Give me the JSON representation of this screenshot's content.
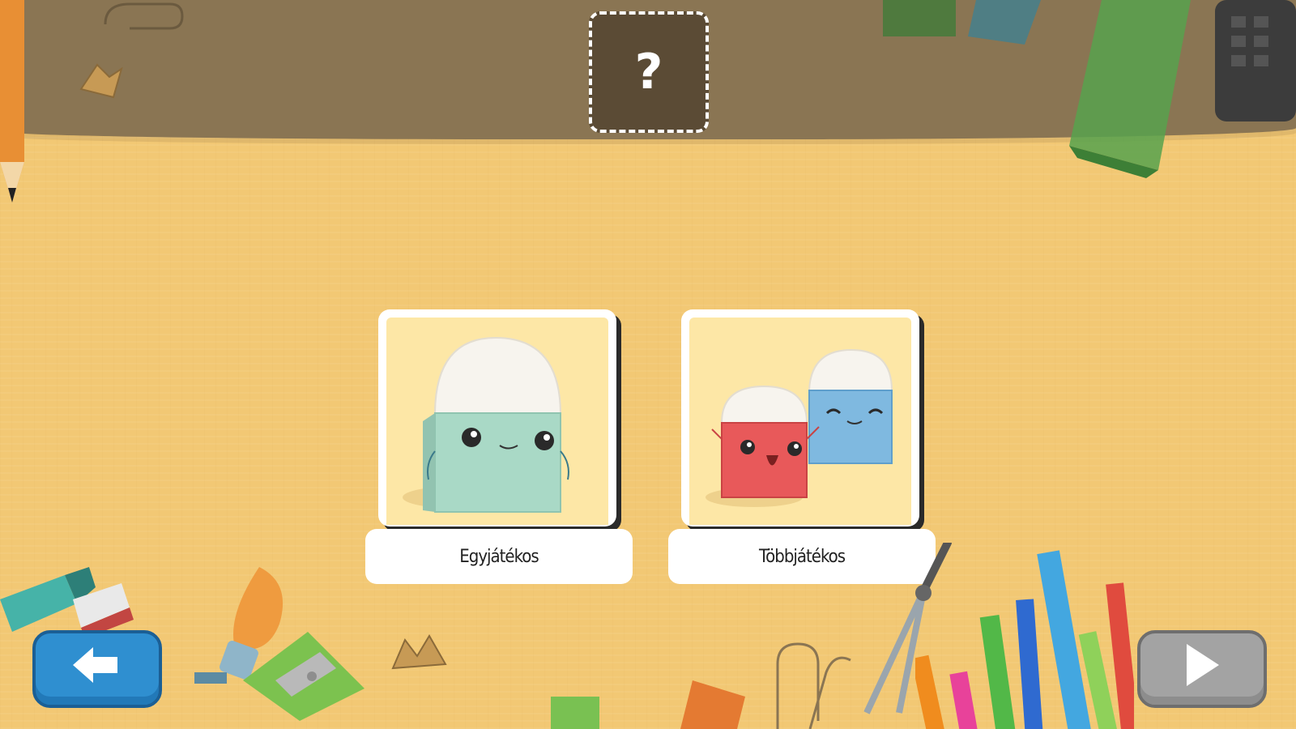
{
  "answer_slot": {
    "symbol": "?"
  },
  "modes": [
    {
      "label": "Egyjátékos"
    },
    {
      "label": "Többjátékos"
    }
  ],
  "nav": {
    "back_icon": "arrow-left-icon",
    "next_icon": "play-triangle-icon"
  },
  "colors": {
    "background": "#f2c874",
    "top_band": "#8a7553",
    "back_button": "#2f8fd0",
    "next_button": "#a3a3a3"
  }
}
